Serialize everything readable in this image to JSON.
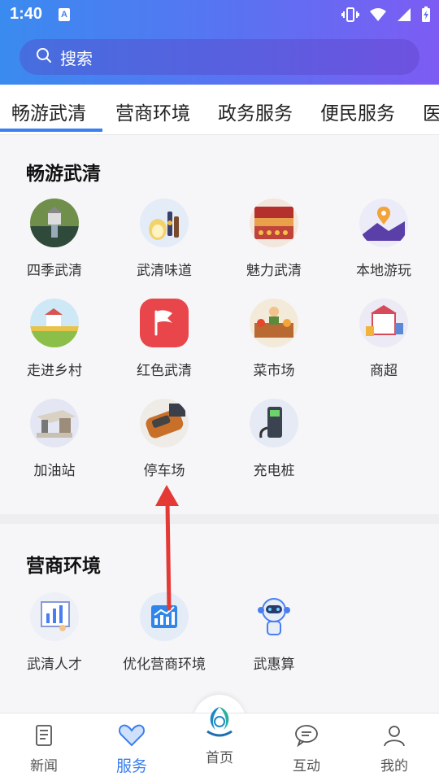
{
  "status_bar": {
    "time": "1:40",
    "notif_letter": "A"
  },
  "search": {
    "placeholder": "搜索"
  },
  "tabs": [
    {
      "label": "畅游武清",
      "active": true
    },
    {
      "label": "营商环境"
    },
    {
      "label": "政务服务"
    },
    {
      "label": "便民服务"
    },
    {
      "label": "医"
    }
  ],
  "sections": [
    {
      "title": "畅游武清",
      "items": [
        {
          "label": "四季武清",
          "icon": "landscape-tower-icon"
        },
        {
          "label": "武清味道",
          "icon": "fruit-bottles-icon"
        },
        {
          "label": "魅力武清",
          "icon": "stage-theater-icon"
        },
        {
          "label": "本地游玩",
          "icon": "map-pin-icon"
        },
        {
          "label": "走进乡村",
          "icon": "farm-house-icon"
        },
        {
          "label": "红色武清",
          "icon": "red-flag-icon"
        },
        {
          "label": "菜市场",
          "icon": "market-stall-icon"
        },
        {
          "label": "商超",
          "icon": "shopping-mall-icon"
        },
        {
          "label": "加油站",
          "icon": "gas-station-icon"
        },
        {
          "label": "停车场",
          "icon": "parking-car-icon"
        },
        {
          "label": "充电桩",
          "icon": "charging-pile-icon"
        }
      ]
    },
    {
      "title": "营商环境",
      "items": [
        {
          "label": "武清人才",
          "icon": "talent-chart-icon"
        },
        {
          "label": "优化营商环境",
          "icon": "business-chart-icon"
        },
        {
          "label": "武惠算",
          "icon": "robot-icon"
        }
      ]
    }
  ],
  "bottom_nav": [
    {
      "label": "新闻",
      "icon": "news-icon"
    },
    {
      "label": "服务",
      "icon": "heart-icon",
      "active": true
    },
    {
      "label": "首页",
      "icon": "home-logo-icon"
    },
    {
      "label": "互动",
      "icon": "chat-icon"
    },
    {
      "label": "我的",
      "icon": "user-icon"
    }
  ],
  "colors": {
    "accent": "#3a7ef0",
    "header_start": "#3a8bf0",
    "header_end": "#7d5cf3",
    "arrow": "#e53935"
  }
}
